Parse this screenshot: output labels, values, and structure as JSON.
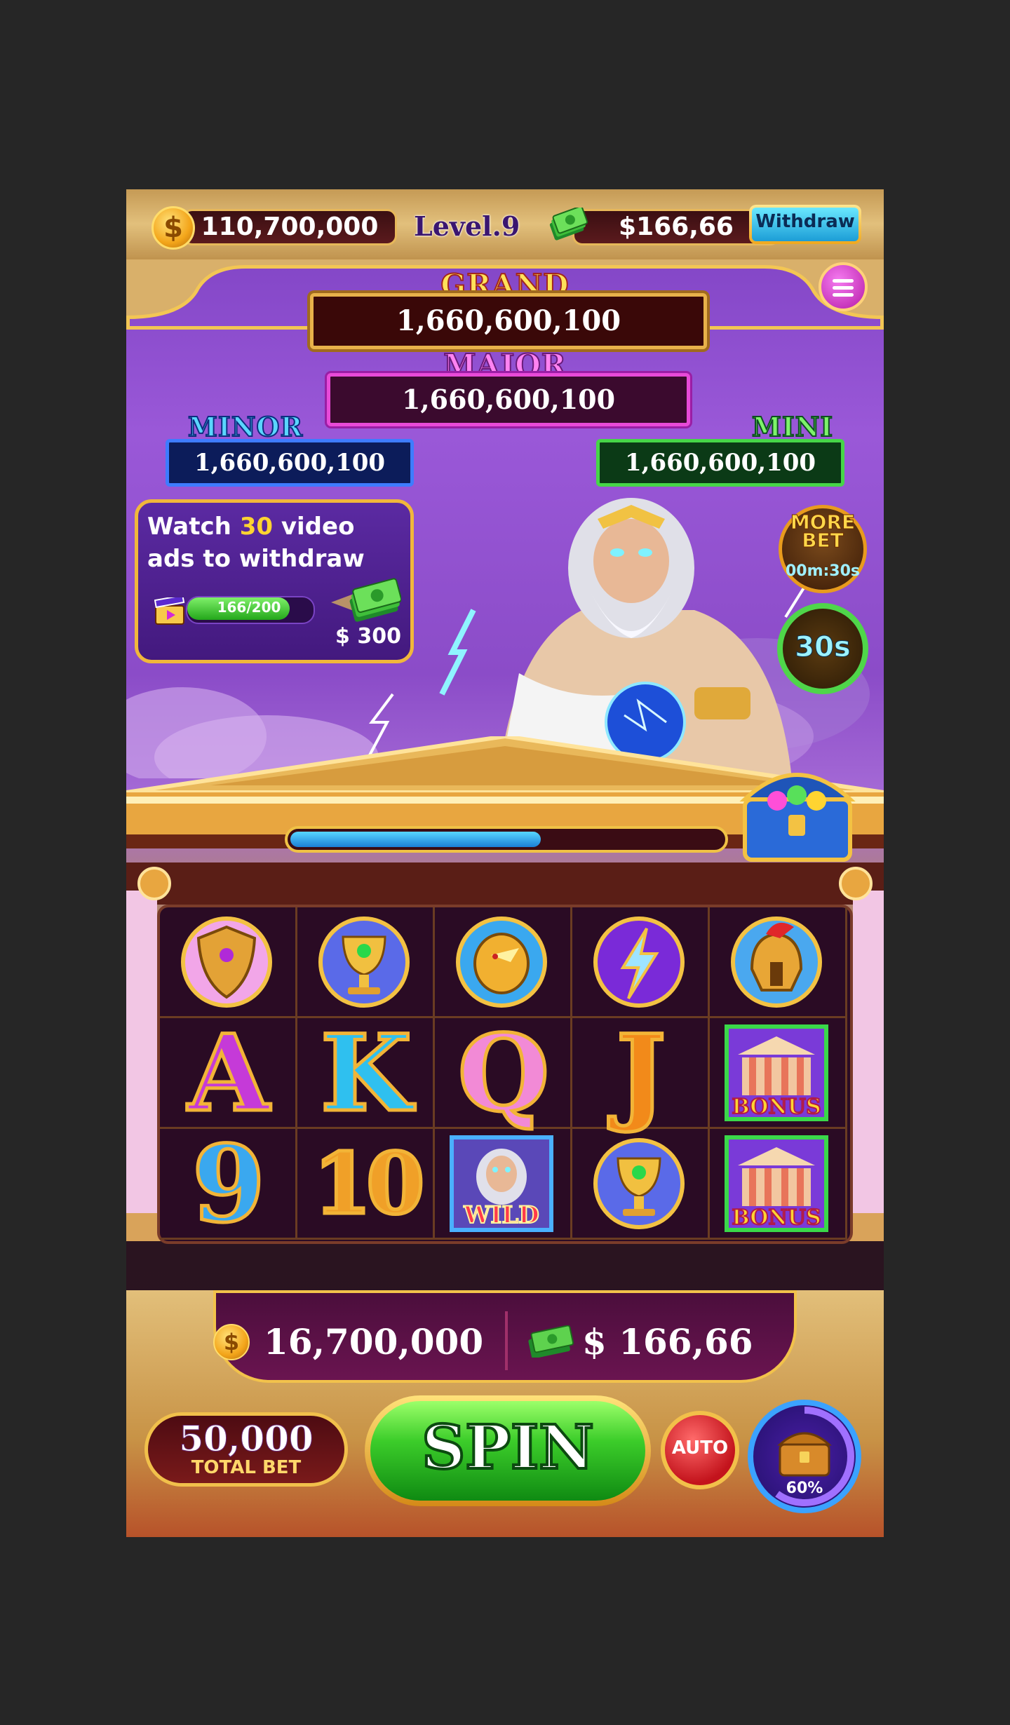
{
  "header": {
    "coins": "110,700,000",
    "level": "Level.9",
    "cash": "$166,66",
    "withdraw_label": "Withdraw"
  },
  "jackpots": {
    "grand": {
      "title": "GRAND",
      "value": "1,660,600,100"
    },
    "major": {
      "title": "MAJOR",
      "value": "1,660,600,100"
    },
    "minor": {
      "title": "MINOR",
      "value": "1,660,600,100"
    },
    "mini": {
      "title": "MINI",
      "value": "1,660,600,100"
    }
  },
  "ads_panel": {
    "line1_pre": "Watch ",
    "line1_count": "30",
    "line1_post": " video",
    "line2": "ads to withdraw",
    "progress_text": "166/200",
    "progress_fraction": 0.83,
    "reward": "$ 300"
  },
  "side_buttons": {
    "more_bet_label": "MORE BET",
    "more_bet_timer": "00m:30s",
    "timer_label": "30s"
  },
  "level_progress_fraction": 0.58,
  "reels": {
    "rows": [
      [
        "shield-icon",
        "trophy-icon",
        "eagle-ring-icon",
        "lightning-icon",
        "helmet-icon"
      ],
      [
        "A",
        "K",
        "Q",
        "J",
        "bonus-temple-icon"
      ],
      [
        "9",
        "10",
        "wild-zeus-icon",
        "trophy-icon",
        "bonus-temple-icon"
      ]
    ],
    "wild_label": "WILD",
    "bonus_label": "BONUS"
  },
  "bottom": {
    "win_coins": "16,700,000",
    "win_cash": "$ 166,66",
    "total_bet_value": "50,000",
    "total_bet_label": "TOTAL BET",
    "spin_label": "SPIN",
    "auto_label": "AUTO",
    "bonus_percent": "60%",
    "bonus_fraction": 0.6
  },
  "colors": {
    "sky": "#8b4cc8",
    "gold": "#e8b14a",
    "grand": "#ffe15a",
    "major": "#ff83f2",
    "minor": "#5ad6ff",
    "mini": "#7df36a",
    "spin": "#3ccd2a"
  }
}
